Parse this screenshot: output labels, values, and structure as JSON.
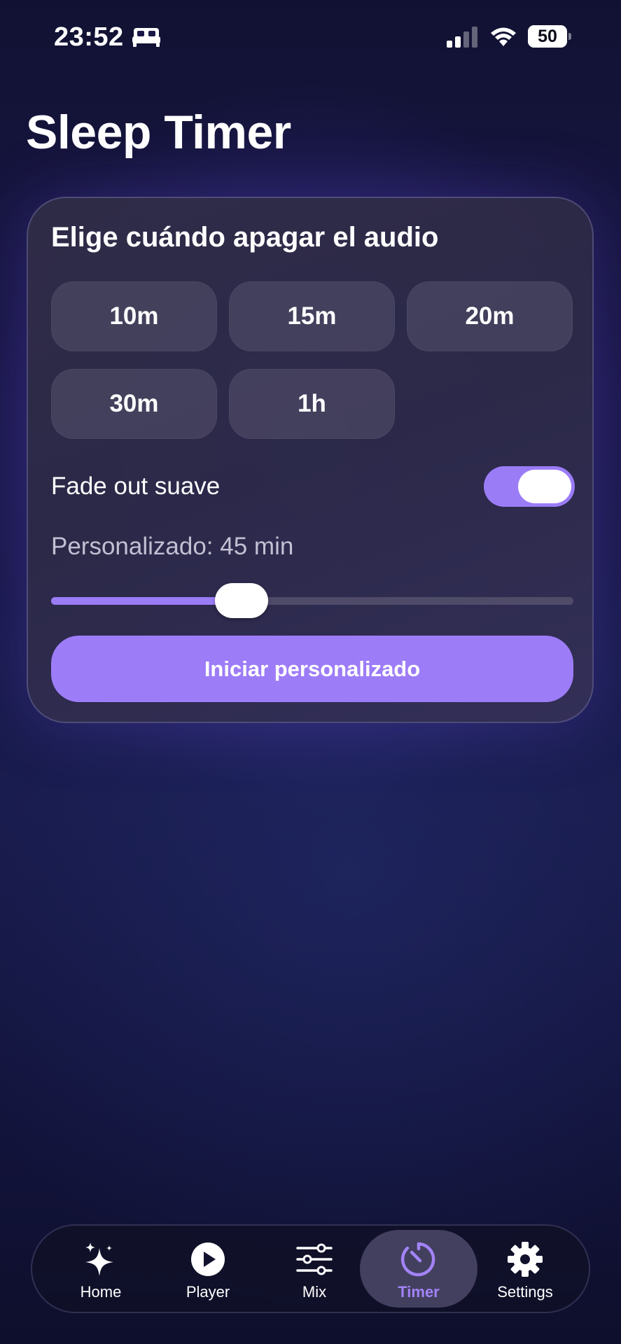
{
  "status_bar": {
    "time": "23:52",
    "focus_icon": "bed-icon",
    "battery_level": "50",
    "battery_fraction": 0.5
  },
  "page": {
    "title": "Sleep Timer"
  },
  "card": {
    "heading": "Elige cuándo apagar el audio",
    "presets": [
      "10m",
      "15m",
      "20m",
      "30m",
      "1h"
    ],
    "fade_label": "Fade out suave",
    "fade_enabled": true,
    "custom_label": "Personalizado: 45 min",
    "slider_fraction": 0.365,
    "start_button_label": "Iniciar personalizado"
  },
  "tab_bar": {
    "tabs": [
      {
        "label": "Home",
        "icon": "sparkles-icon"
      },
      {
        "label": "Player",
        "icon": "play-circle-icon"
      },
      {
        "label": "Mix",
        "icon": "sliders-icon"
      },
      {
        "label": "Timer",
        "icon": "timer-icon"
      },
      {
        "label": "Settings",
        "icon": "gear-icon"
      }
    ],
    "active": "Timer"
  },
  "colors": {
    "accent": "#9d7cf8",
    "active_tab_label": "#a383f7",
    "background_top": "#111233",
    "card": "#2e2b48"
  }
}
